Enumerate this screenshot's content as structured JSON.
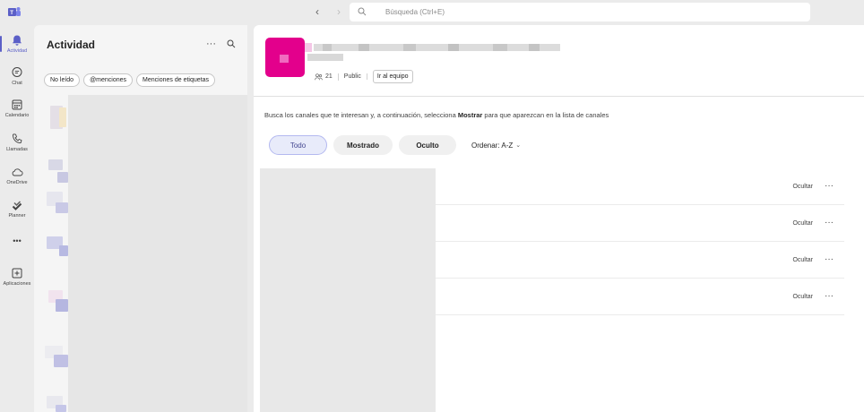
{
  "search": {
    "placeholder": "Búsqueda (Ctrl+E)"
  },
  "nav": {
    "back": "‹",
    "forward": "›"
  },
  "rail": {
    "items": [
      {
        "label": "Actividad"
      },
      {
        "label": "Chat"
      },
      {
        "label": "Calendario"
      },
      {
        "label": "Llamadas"
      },
      {
        "label": "OneDrive"
      },
      {
        "label": "Planner"
      },
      {
        "label": "•••"
      },
      {
        "label": "Aplicaciones"
      }
    ]
  },
  "activity": {
    "title": "Actividad",
    "more": "···",
    "filters": [
      "No leído",
      "@menciones",
      "Menciones de etiquetas"
    ]
  },
  "team": {
    "members_count": "21",
    "privacy": "Public",
    "go_to_team": "Ir al equipo"
  },
  "main": {
    "instructions_before": "Busca los canales que te interesan y, a continuación, selecciona ",
    "instructions_bold": "Mostrar",
    "instructions_after": " para que aparezcan en la lista de canales",
    "tabs": [
      "Todo",
      "Mostrado",
      "Oculto"
    ],
    "sort_label": "Ordenar: A-Z",
    "sort_chevron": "⌄",
    "rows": [
      {
        "hide_label": "Ocultar",
        "more": "···"
      },
      {
        "hide_label": "Ocultar",
        "more": "···"
      },
      {
        "hide_label": "Ocultar",
        "more": "···"
      },
      {
        "hide_label": "Ocultar",
        "more": "···"
      }
    ]
  },
  "colors": {
    "accent": "#5b5fc7",
    "team_avatar": "#e3008c",
    "selected_tab_bg": "#e8ebfa"
  }
}
